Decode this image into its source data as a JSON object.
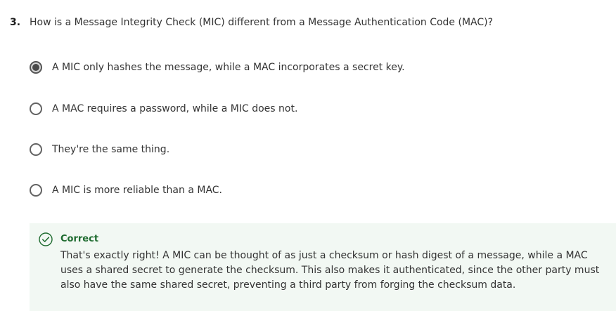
{
  "question": {
    "number": "3.",
    "text": "How is a Message Integrity Check (MIC) different from a Message Authentication Code (MAC)?"
  },
  "options": [
    {
      "label": "A MIC only hashes the message, while a MAC incorporates a secret key.",
      "selected": true
    },
    {
      "label": "A MAC requires a password, while a MIC does not.",
      "selected": false
    },
    {
      "label": "They're the same thing.",
      "selected": false
    },
    {
      "label": "A MIC is more reliable than a MAC.",
      "selected": false
    }
  ],
  "feedback": {
    "status": "Correct",
    "text": "That's exactly right! A MIC can be thought of as just a checksum or hash digest of a message, while a MAC uses a shared secret to generate the checksum. This also makes it authenticated, since the other party must also have the same shared secret, preventing a third party from forging the checksum data.",
    "accent_color": "#1e6b2f",
    "background_color": "#f2f8f3",
    "icon": "check-circle-icon"
  }
}
